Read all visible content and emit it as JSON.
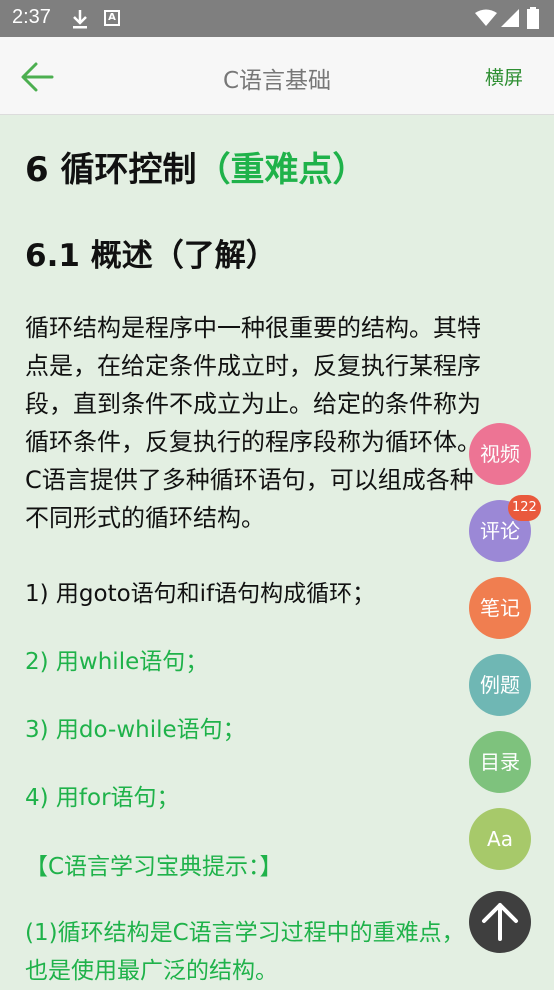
{
  "status_bar": {
    "time": "2:37",
    "download_icon": "download-icon",
    "a_icon": "A",
    "wifi_icon": "wifi-icon",
    "signal_icon": "signal-icon",
    "battery_icon": "battery-icon"
  },
  "app_bar": {
    "title": "C语言基础",
    "landscape_label": "横屏",
    "back_icon": "back-arrow-icon",
    "accent_color": "#2f8f33"
  },
  "content": {
    "heading1": "6 循环控制",
    "heading1_accent": "（重难点）",
    "heading2": "6.1 概述（了解）",
    "paragraph_lines": [
      "循环结构是程序中一种很重要的结构。其特",
      "点是，在给定条件成立时，反复执行某程序",
      "段，直到条件不成立为止。给定的条件称为",
      "循环条件，反复执行的程序段称为循环体。",
      "C语言提供了多种循环语句，可以组成各种",
      "不同形式的循环结构。"
    ],
    "list_items": [
      "1) 用goto语句和if语句构成循环；",
      "2) 用while语句；",
      "3) 用do-while语句；",
      "4) 用for语句；"
    ],
    "tip_title": "【C语言学习宝典提示：】",
    "tip_lines": [
      "(1)循环结构是C语言学习过程中的重难点，",
      "也是使用最广泛的结构。"
    ],
    "accent_color": "#1fb24a"
  },
  "fabs": {
    "video": "视频",
    "comment": "评论",
    "comment_badge": "122",
    "notes": "笔记",
    "example": "例题",
    "toc": "目录",
    "font": "Aa",
    "scroll_top_icon": "arrow-up-icon"
  }
}
